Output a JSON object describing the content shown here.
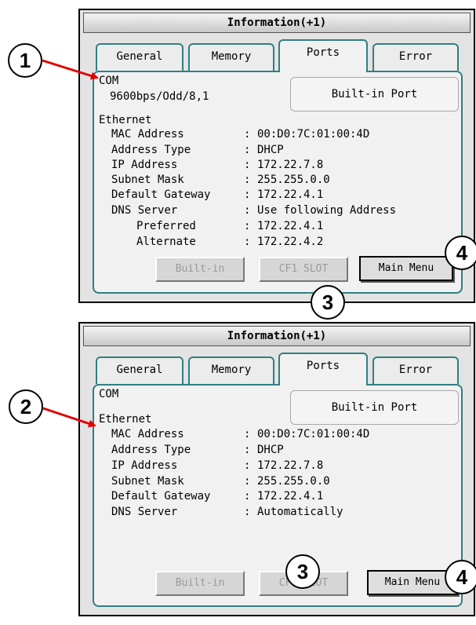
{
  "screens": [
    {
      "title": "Information(+1)",
      "tabs": [
        "General",
        "Memory",
        "Ports",
        "Error"
      ],
      "active_tab": "Ports",
      "com_heading": "COM",
      "com_setting": "9600bps/Odd/8,1",
      "builtin_port_label": "Built-in Port",
      "ethernet_heading": "Ethernet",
      "rows": [
        {
          "label": "MAC Address",
          "value": "00:D0:7C:01:00:4D"
        },
        {
          "label": "Address Type",
          "value": "DHCP"
        },
        {
          "label": "IP Address",
          "value": "172.22.7.8"
        },
        {
          "label": "Subnet Mask",
          "value": "255.255.0.0"
        },
        {
          "label": "Default Gateway",
          "value": "172.22.4.1"
        },
        {
          "label": "DNS Server",
          "value": "Use following Address"
        },
        {
          "label": "Preferred",
          "value": "172.22.4.1"
        },
        {
          "label": "Alternate",
          "value": "172.22.4.2"
        }
      ],
      "buttons": {
        "builtin": "Built-in",
        "cf1": "CF1 SLOT",
        "main_menu": "Main Menu"
      }
    },
    {
      "title": "Information(+1)",
      "tabs": [
        "General",
        "Memory",
        "Ports",
        "Error"
      ],
      "active_tab": "Ports",
      "com_heading": "COM",
      "builtin_port_label": "Built-in Port",
      "ethernet_heading": "Ethernet",
      "rows": [
        {
          "label": "MAC Address",
          "value": "00:D0:7C:01:00:4D"
        },
        {
          "label": "Address Type",
          "value": "DHCP"
        },
        {
          "label": "IP Address",
          "value": "172.22.7.8"
        },
        {
          "label": "Subnet Mask",
          "value": "255.255.0.0"
        },
        {
          "label": "Default Gateway",
          "value": "172.22.4.1"
        },
        {
          "label": "DNS Server",
          "value": "Automatically"
        }
      ],
      "buttons": {
        "builtin": "Built-in",
        "cf1": "CF1 SLOT",
        "main_menu": "Main Menu"
      }
    }
  ],
  "callouts": [
    "1",
    "2",
    "3",
    "4"
  ],
  "value_separator": ":",
  "colors": {
    "arrow": "#e00000",
    "tab_border": "#2f7f82",
    "screen_bg": "#e3e3e3",
    "panel_bg": "#f1f1f1"
  }
}
